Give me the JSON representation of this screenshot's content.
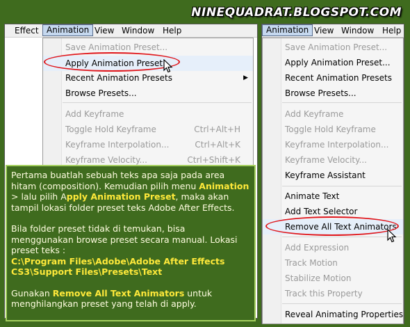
{
  "site_title": "NINEQUADRAT.BLOGSPOT.COM",
  "left_menubar": [
    "Effect",
    "Animation",
    "View",
    "Window",
    "Help"
  ],
  "right_menubar": [
    "Animation",
    "View",
    "Window",
    "Help"
  ],
  "left_menu": [
    {
      "label": "Save Animation Preset...",
      "disabled": true
    },
    {
      "label": "Apply Animation Preset...",
      "disabled": false,
      "circled": true
    },
    {
      "label": "Recent Animation Presets",
      "disabled": false,
      "submenu": true
    },
    {
      "label": "Browse Presets...",
      "disabled": false
    },
    {
      "label": "Add Keyframe",
      "disabled": true
    },
    {
      "label": "Toggle Hold Keyframe",
      "disabled": true,
      "shortcut": "Ctrl+Alt+H"
    },
    {
      "label": "Keyframe Interpolation...",
      "disabled": true,
      "shortcut": "Ctrl+Alt+K"
    },
    {
      "label": "Keyframe Velocity...",
      "disabled": true,
      "shortcut": "Ctrl+Shift+K"
    }
  ],
  "right_menu": [
    {
      "label": "Save Animation Preset...",
      "disabled": true
    },
    {
      "label": "Apply Animation Preset...",
      "disabled": false
    },
    {
      "label": "Recent Animation Presets",
      "disabled": false
    },
    {
      "label": "Browse Presets...",
      "disabled": false
    },
    {
      "label": "Add Keyframe",
      "disabled": true
    },
    {
      "label": "Toggle Hold Keyframe",
      "disabled": true
    },
    {
      "label": "Keyframe Interpolation...",
      "disabled": true
    },
    {
      "label": "Keyframe Velocity...",
      "disabled": true
    },
    {
      "label": "Keyframe Assistant",
      "disabled": false
    },
    {
      "label": "Animate Text",
      "disabled": false
    },
    {
      "label": "Add Text Selector",
      "disabled": false
    },
    {
      "label": "Remove All Text Animators",
      "disabled": false,
      "circled": true
    },
    {
      "label": "Add Expression",
      "disabled": true
    },
    {
      "label": "Track Motion",
      "disabled": true
    },
    {
      "label": "Stabilize Motion",
      "disabled": true
    },
    {
      "label": "Track this Property",
      "disabled": true
    },
    {
      "label": "Reveal Animating Properties",
      "disabled": false
    }
  ],
  "info": {
    "p1_a": "Pertama buatlah sebuah teks apa saja pada area hitam (composition). Kemudian pilih menu ",
    "p1_b1": "Animation",
    "p1_c": " > lalu pilih A",
    "p1_b2": "pply Animation Preset",
    "p1_d": ", maka akan tampil lokasi folder preset teks Adobe After Effects.",
    "p2": "Bila folder preset tidak di temukan, bisa menggunakan browse preset secara manual. Lokasi preset teks :",
    "path1": "C:\\Program Files\\Adobe\\Adobe After Effects",
    "path2": "CS3\\Support Files\\Presets\\Text",
    "p3_a": "Gunakan ",
    "p3_b": "Remove All Text Animators",
    "p3_c": " untuk menghilangkan preset yang telah di apply."
  }
}
